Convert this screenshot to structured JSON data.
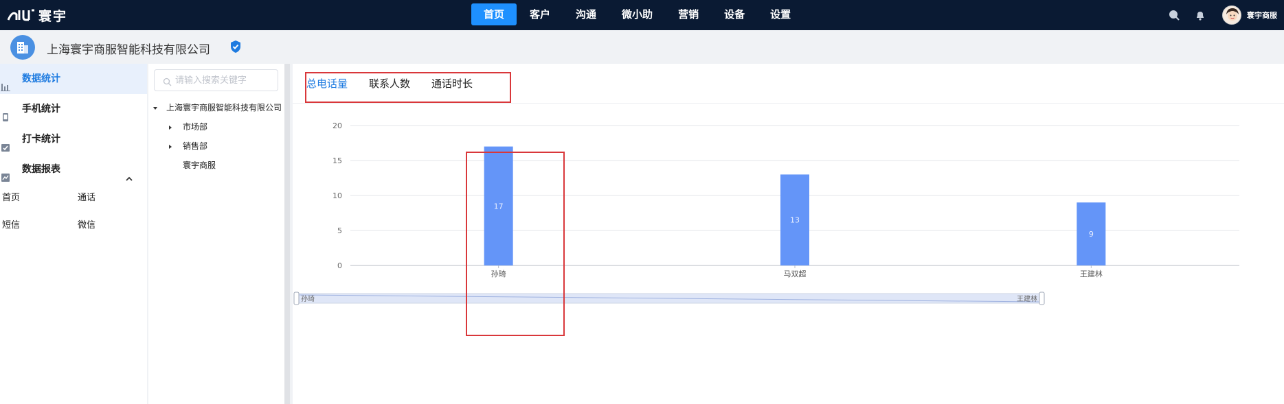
{
  "app": {
    "logo_text": "寰宇",
    "nav": [
      {
        "label": "首页",
        "active": true
      },
      {
        "label": "客户",
        "active": false
      },
      {
        "label": "沟通",
        "active": false
      },
      {
        "label": "微小助",
        "active": false
      },
      {
        "label": "营销",
        "active": false
      },
      {
        "label": "设备",
        "active": false
      },
      {
        "label": "设置",
        "active": false
      }
    ],
    "user_name": "寰宇商服",
    "icons": [
      "search-icon",
      "bell-icon",
      "avatar"
    ]
  },
  "company": {
    "name": "上海寰宇商服智能科技有限公司",
    "verified_icon": "shield-check-icon"
  },
  "sidebar": {
    "items": [
      {
        "label": "数据统计",
        "icon": "bar-chart-icon",
        "active": true
      },
      {
        "label": "手机统计",
        "icon": "phone-icon",
        "active": false
      },
      {
        "label": "打卡统计",
        "icon": "calendar-check-icon",
        "active": false
      },
      {
        "label": "数据报表",
        "icon": "line-chart-icon",
        "active": false,
        "expanded": true
      }
    ],
    "sub_items": [
      "首页",
      "通话",
      "短信",
      "微信"
    ]
  },
  "tree": {
    "search_placeholder": "请输入搜索关键字",
    "nodes": [
      {
        "label": "上海寰宇商服智能科技有限公司",
        "level": 0,
        "caret": "down"
      },
      {
        "label": "市场部",
        "level": 1,
        "caret": "right"
      },
      {
        "label": "销售部",
        "level": 1,
        "caret": "right"
      },
      {
        "label": "寰宇商服",
        "level": 1,
        "caret": "none"
      }
    ]
  },
  "main": {
    "tabs": [
      {
        "label": "总电话量",
        "active": true
      },
      {
        "label": "联系人数",
        "active": false
      },
      {
        "label": "通话时长",
        "active": false
      }
    ]
  },
  "chart_data": {
    "type": "bar",
    "categories": [
      "孙琦",
      "马双超",
      "王建林"
    ],
    "values": [
      17,
      13,
      9
    ],
    "ylim": [
      0,
      20
    ],
    "yticks": [
      0,
      5,
      10,
      15,
      20
    ],
    "grid": true,
    "bar_color": "#6495f8",
    "data_label_color": "#e8eeff",
    "slider": {
      "start_label": "孙琦",
      "end_label": "王建林"
    }
  },
  "colors": {
    "topbar": "#0a1a33",
    "accent": "#1e90ff",
    "highlight": "#d9373a"
  }
}
